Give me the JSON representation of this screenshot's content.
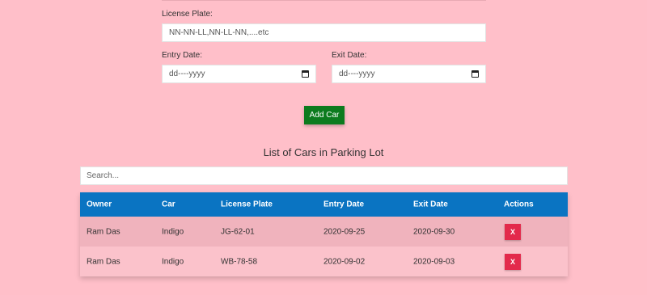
{
  "form": {
    "license_plate_label": "License Plate:",
    "license_plate_placeholder": "NN-NN-LL,NN-LL-NN,....etc",
    "entry_date_label": "Entry Date:",
    "entry_date_placeholder": "dd----yyyy",
    "exit_date_label": "Exit Date:",
    "exit_date_placeholder": "dd----yyyy",
    "add_button": "Add Car"
  },
  "list": {
    "title": "List of Cars in Parking Lot",
    "search_placeholder": "Search...",
    "headers": [
      "Owner",
      "Car",
      "License Plate",
      "Entry Date",
      "Exit Date",
      "Actions"
    ],
    "rows": [
      {
        "owner": "Ram Das",
        "car": "Indigo",
        "plate": "JG-62-01",
        "entry": "2020-09-25",
        "exit": "2020-09-30",
        "action": "X"
      },
      {
        "owner": "Ram Das",
        "car": "Indigo",
        "plate": "WB-78-58",
        "entry": "2020-09-02",
        "exit": "2020-09-03",
        "action": "X"
      }
    ]
  },
  "colors": {
    "background": "#ffbfc9",
    "header": "#0a74c2",
    "add_button": "#0c7b1e",
    "delete_button": "#e3294b"
  }
}
